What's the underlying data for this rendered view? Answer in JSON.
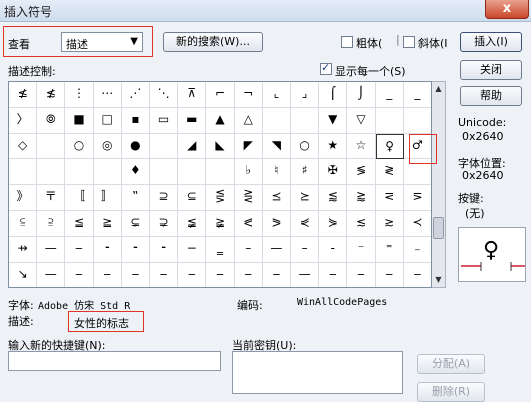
{
  "window": {
    "title": "插入符号",
    "close_glyph": "x"
  },
  "view": {
    "label": "查看",
    "combo_value": "描述",
    "new_search_button": "新的搜索(W)...",
    "bold_label": "粗体(",
    "italic_label": "斜体(I",
    "insert_button": "插入(I)",
    "close_button": "关闭",
    "help_button": "帮助"
  },
  "desc_control": {
    "label": "描述控制:",
    "show_each_label": "显示每一个(S)"
  },
  "grid": {
    "rows": [
      [
        "≰",
        "≴",
        "⋮",
        "⋯",
        "⋰",
        "⋱",
        "⊼",
        "⌐",
        "¬",
        "⌞",
        "⌟",
        "⌠",
        "⌡",
        "_",
        "_"
      ],
      [
        "〉",
        "⦾",
        "■",
        "□",
        "▪",
        "▭",
        "▬",
        "▲",
        "△",
        "",
        "",
        "▼",
        "▽",
        "",
        ""
      ],
      [
        "◇",
        "",
        "○",
        "◎",
        "●",
        "",
        "◢",
        "◣",
        "◤",
        "◥",
        "○",
        "★",
        "☆",
        "♀",
        "♂"
      ],
      [
        "",
        "",
        "",
        "",
        "♦",
        "",
        "",
        "",
        "♭",
        "♮",
        "♯",
        "✠",
        "≶",
        "≷",
        ""
      ],
      [
        "》",
        "〒",
        "〚",
        "〛",
        "‟",
        "⊇",
        "⊆",
        "⋚",
        "⋛",
        "⪯",
        "⪰",
        "⪅",
        "⪆",
        "⋜",
        "⋝"
      ],
      [
        "⫅",
        "⫆",
        "≦",
        "≧",
        "⊊",
        "⊋",
        "≨",
        "≩",
        "⪕",
        "⪖",
        "⋞",
        "⋟",
        "≲",
        "≳",
        "≺"
      ],
      [
        "⇸",
        "—",
        "‒",
        "⁃",
        "⁃",
        "⁃",
        "−",
        "‗",
        "–",
        "—",
        "–",
        "‐",
        "⁻",
        "⁼",
        "₋"
      ],
      [
        "↘",
        "—",
        "‒",
        "‒",
        "‒",
        "‒",
        "‒",
        "‒",
        "‒",
        "‒",
        "—",
        "‒",
        "‒",
        "‒",
        "‒"
      ]
    ]
  },
  "info": {
    "unicode_label": "Unicode:",
    "unicode_value": "0x2640",
    "font_pos_label": "字体位置:",
    "font_pos_value": "0x2640",
    "key_label": "按键:",
    "key_value": "(无)",
    "preview_glyph": "♀"
  },
  "footer": {
    "font_label": "字体:",
    "font_value": "Adobe 仿宋 Std R",
    "encoding_label": "编码:",
    "encoding_value": "WinAllCodePages",
    "desc_label": "描述:",
    "desc_value": "女性的标志"
  },
  "shortcut": {
    "new_label": "输入新的快捷键(N):",
    "current_label": "当前密钥(U):",
    "assign_button": "分配(A)",
    "remove_button": "删除(R)"
  },
  "colors": {
    "highlight_box": "#e0342a",
    "preview_marker": "#c8202e"
  }
}
